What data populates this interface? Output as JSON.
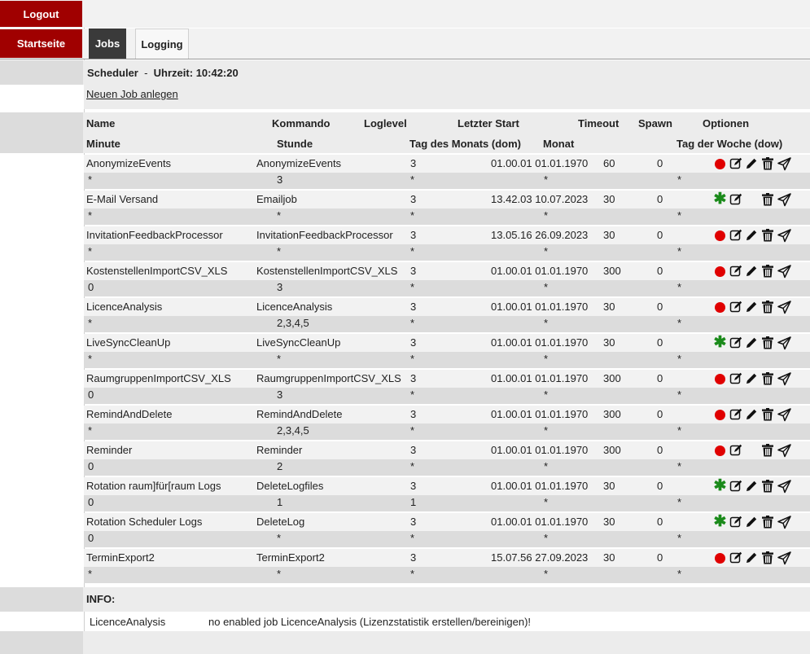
{
  "nav": {
    "logout": "Logout",
    "startseite": "Startseite"
  },
  "tabs": [
    {
      "label": "Jobs"
    },
    {
      "label": "Logging"
    }
  ],
  "scheduler": {
    "title": "Scheduler",
    "sep": "-",
    "time_label": "Uhrzeit:",
    "time": "10:42:20"
  },
  "new_job_link": "Neuen Job anlegen",
  "headers": {
    "name": "Name",
    "kommando": "Kommando",
    "loglevel": "Loglevel",
    "letzter_start": "Letzter Start",
    "timeout": "Timeout",
    "spawn": "Spawn",
    "optionen": "Optionen",
    "minute": "Minute",
    "stunde": "Stunde",
    "dom": "Tag des Monats (dom)",
    "monat": "Monat",
    "dow": "Tag der Woche (dow)"
  },
  "jobs": [
    {
      "name": "AnonymizeEvents",
      "kommando": "AnonymizeEvents",
      "loglevel": "3",
      "letzter_start": "01.00.01 01.01.1970",
      "timeout": "60",
      "spawn": "0",
      "status": "disabled",
      "minute": "*",
      "stunde": "3",
      "dom": "*",
      "monat": "*",
      "dow": "*",
      "has_edit": true
    },
    {
      "name": "E-Mail Versand",
      "kommando": "Emailjob",
      "loglevel": "3",
      "letzter_start": "13.42.03 10.07.2023",
      "timeout": "30",
      "spawn": "0",
      "status": "enabled",
      "minute": "*",
      "stunde": "*",
      "dom": "*",
      "monat": "*",
      "dow": "*",
      "has_edit": false
    },
    {
      "name": "InvitationFeedbackProcessor",
      "kommando": "InvitationFeedbackProcessor",
      "loglevel": "3",
      "letzter_start": "13.05.16 26.09.2023",
      "timeout": "30",
      "spawn": "0",
      "status": "disabled",
      "minute": "*",
      "stunde": "*",
      "dom": "*",
      "monat": "*",
      "dow": "*",
      "has_edit": true
    },
    {
      "name": "KostenstellenImportCSV_XLS",
      "kommando": "KostenstellenImportCSV_XLS",
      "loglevel": "3",
      "letzter_start": "01.00.01 01.01.1970",
      "timeout": "300",
      "spawn": "0",
      "status": "disabled",
      "minute": "0",
      "stunde": "3",
      "dom": "*",
      "monat": "*",
      "dow": "*",
      "has_edit": true
    },
    {
      "name": "LicenceAnalysis",
      "kommando": "LicenceAnalysis",
      "loglevel": "3",
      "letzter_start": "01.00.01 01.01.1970",
      "timeout": "30",
      "spawn": "0",
      "status": "disabled",
      "minute": "*",
      "stunde": "2,3,4,5",
      "dom": "*",
      "monat": "*",
      "dow": "*",
      "has_edit": true
    },
    {
      "name": "LiveSyncCleanUp",
      "kommando": "LiveSyncCleanUp",
      "loglevel": "3",
      "letzter_start": "01.00.01 01.01.1970",
      "timeout": "30",
      "spawn": "0",
      "status": "enabled",
      "minute": "*",
      "stunde": "*",
      "dom": "*",
      "monat": "*",
      "dow": "*",
      "has_edit": true
    },
    {
      "name": "RaumgruppenImportCSV_XLS",
      "kommando": "RaumgruppenImportCSV_XLS",
      "loglevel": "3",
      "letzter_start": "01.00.01 01.01.1970",
      "timeout": "300",
      "spawn": "0",
      "status": "disabled",
      "minute": "0",
      "stunde": "3",
      "dom": "*",
      "monat": "*",
      "dow": "*",
      "has_edit": true
    },
    {
      "name": "RemindAndDelete",
      "kommando": "RemindAndDelete",
      "loglevel": "3",
      "letzter_start": "01.00.01 01.01.1970",
      "timeout": "300",
      "spawn": "0",
      "status": "disabled",
      "minute": "*",
      "stunde": "2,3,4,5",
      "dom": "*",
      "monat": "*",
      "dow": "*",
      "has_edit": true
    },
    {
      "name": "Reminder",
      "kommando": "Reminder",
      "loglevel": "3",
      "letzter_start": "01.00.01 01.01.1970",
      "timeout": "300",
      "spawn": "0",
      "status": "disabled",
      "minute": "0",
      "stunde": "2",
      "dom": "*",
      "monat": "*",
      "dow": "*",
      "has_edit": false
    },
    {
      "name": "Rotation raum]für[raum Logs",
      "kommando": "DeleteLogfiles",
      "loglevel": "3",
      "letzter_start": "01.00.01 01.01.1970",
      "timeout": "30",
      "spawn": "0",
      "status": "enabled",
      "minute": "0",
      "stunde": "1",
      "dom": "1",
      "monat": "*",
      "dow": "*",
      "has_edit": true
    },
    {
      "name": "Rotation Scheduler Logs",
      "kommando": "DeleteLog",
      "loglevel": "3",
      "letzter_start": "01.00.01 01.01.1970",
      "timeout": "30",
      "spawn": "0",
      "status": "enabled",
      "minute": "0",
      "stunde": "*",
      "dom": "*",
      "monat": "*",
      "dow": "*",
      "has_edit": true
    },
    {
      "name": "TerminExport2",
      "kommando": "TerminExport2",
      "loglevel": "3",
      "letzter_start": "15.07.56 27.09.2023",
      "timeout": "30",
      "spawn": "0",
      "status": "disabled",
      "minute": "*",
      "stunde": "*",
      "dom": "*",
      "monat": "*",
      "dow": "*",
      "has_edit": true
    }
  ],
  "info": {
    "label": "INFO:",
    "job": "LicenceAnalysis",
    "message": "no enabled job LicenceAnalysis (Lizenzstatistik erstellen/bereinigen)!"
  },
  "icons": {
    "disabled": "red-dot-icon",
    "enabled": "green-asterisk-icon",
    "detail": "note-edit-icon",
    "edit": "pencil-icon",
    "delete": "trash-icon",
    "run": "send-icon"
  },
  "colors": {
    "brand": "#a00000",
    "disabled": "#e00000",
    "enabled": "#1a8a1a",
    "active_tab": "#3a3a3a"
  }
}
